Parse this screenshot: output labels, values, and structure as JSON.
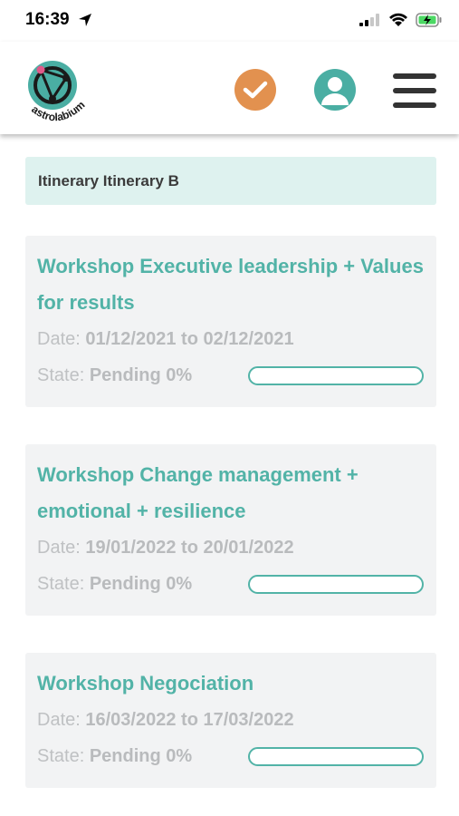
{
  "status_bar": {
    "time": "16:39"
  },
  "header": {
    "logo_text": "astrolabium"
  },
  "itinerary": {
    "label": "Itinerary Itinerary B"
  },
  "labels": {
    "date": "Date:",
    "state": "State:"
  },
  "colors": {
    "accent": "#52b3a7",
    "check_button": "#e2914f",
    "card_bg": "#f2f3f4",
    "itinerary_bg": "#def2ef"
  },
  "workshops": [
    {
      "title": "Workshop Executive leadership + Values for results",
      "dates": "01/12/2021 to 02/12/2021",
      "state": "Pending",
      "progress_text": "0%",
      "progress": 0
    },
    {
      "title": "Workshop Change management + emotional + resilience",
      "dates": "19/01/2022 to 20/01/2022",
      "state": "Pending",
      "progress_text": "0%",
      "progress": 0
    },
    {
      "title": "Workshop Negociation",
      "dates": "16/03/2022 to 17/03/2022",
      "state": "Pending",
      "progress_text": "0%",
      "progress": 0
    }
  ]
}
